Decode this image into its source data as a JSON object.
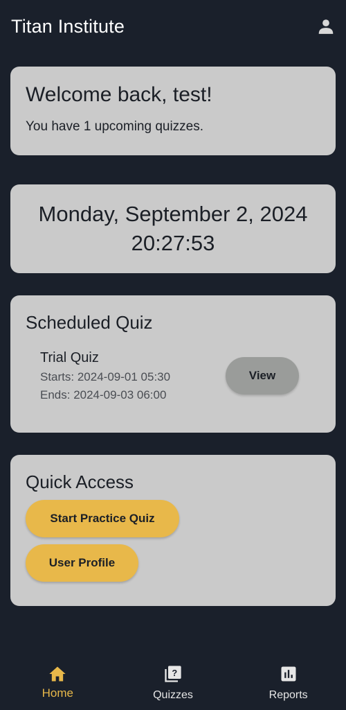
{
  "app": {
    "title": "Titan Institute"
  },
  "welcome": {
    "title": "Welcome back, test!",
    "subtitle": "You have 1 upcoming quizzes."
  },
  "datetime": {
    "date": "Monday, September 2, 2024",
    "time": "20:27:53"
  },
  "scheduled": {
    "title": "Scheduled Quiz",
    "quiz_name": "Trial Quiz",
    "starts": "Starts: 2024-09-01 05:30",
    "ends": "Ends: 2024-09-03 06:00",
    "view_label": "View"
  },
  "quick_access": {
    "title": "Quick Access",
    "practice_label": "Start Practice Quiz",
    "profile_label": "User Profile"
  },
  "nav": {
    "items": [
      {
        "label": "Home",
        "icon": "home-icon",
        "active": true
      },
      {
        "label": "Quizzes",
        "icon": "quiz-icon",
        "active": false
      },
      {
        "label": "Reports",
        "icon": "bar-chart-icon",
        "active": false
      }
    ]
  },
  "colors": {
    "background": "#1a202b",
    "card": "#cacaca",
    "accent": "#e8b84a",
    "view_button": "#9a9c9a"
  }
}
